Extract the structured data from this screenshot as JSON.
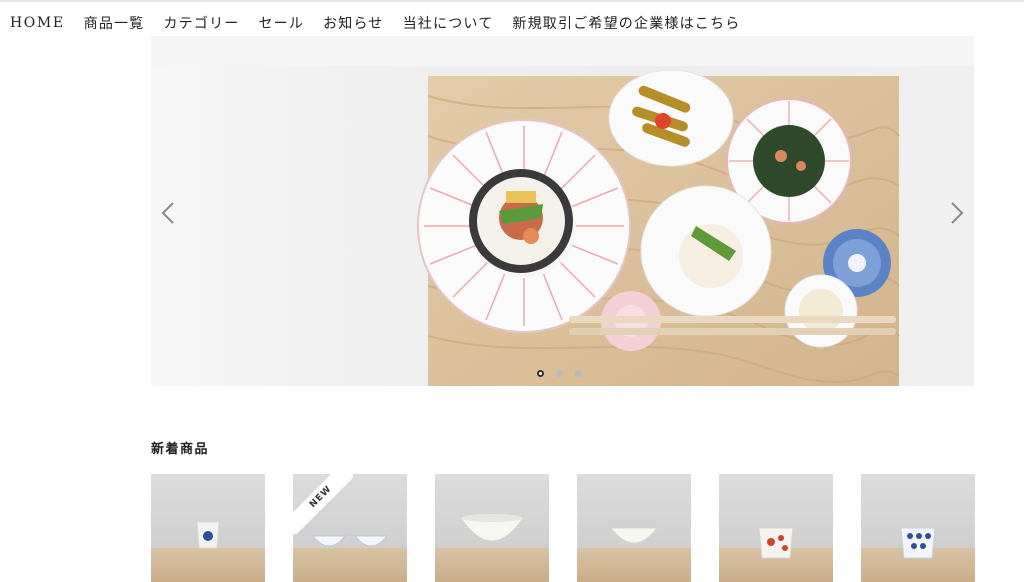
{
  "nav": {
    "items": [
      {
        "label": "HOME"
      },
      {
        "label": "商品一覧"
      },
      {
        "label": "カテゴリー"
      },
      {
        "label": "セール"
      },
      {
        "label": "お知らせ"
      },
      {
        "label": "当社について"
      },
      {
        "label": "新規取引ご希望の企業様はこちら"
      }
    ]
  },
  "hero": {
    "slide_count": 3,
    "active_slide": 1
  },
  "new_arrivals": {
    "title": "新着商品",
    "badge": "NEW"
  },
  "colors": {
    "text": "#222222",
    "dot_inactive": "#b9b9b9",
    "wood": "#d9c3a4"
  }
}
